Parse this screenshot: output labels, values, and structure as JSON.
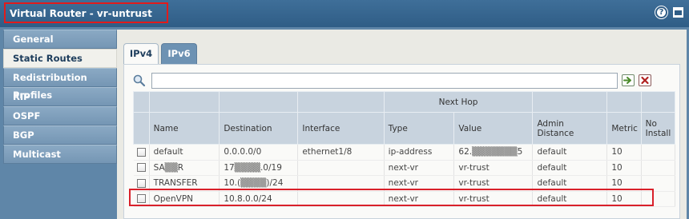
{
  "window": {
    "title": "Virtual Router - vr-untrust",
    "help_icon": "help-icon",
    "window_icon": "window-icon"
  },
  "nav": {
    "items": [
      {
        "label": "General",
        "active": false
      },
      {
        "label": "Static Routes",
        "active": true
      },
      {
        "label": "Redistribution Profiles",
        "active": false
      },
      {
        "label": "RIP",
        "active": false
      },
      {
        "label": "OSPF",
        "active": false
      },
      {
        "label": "BGP",
        "active": false
      },
      {
        "label": "Multicast",
        "active": false
      }
    ]
  },
  "tabs": [
    {
      "label": "IPv4",
      "active": true
    },
    {
      "label": "IPv6",
      "active": false
    }
  ],
  "search": {
    "value": "",
    "placeholder": ""
  },
  "table": {
    "group_header": "Next Hop",
    "columns": [
      "Name",
      "Destination",
      "Interface",
      "Type",
      "Value",
      "Admin Distance",
      "Metric",
      "No Install"
    ],
    "rows": [
      {
        "name": "default",
        "destination": "0.0.0.0/0",
        "interface": "ethernet1/8",
        "type": "ip-address",
        "value": "62.▒▒▒▒▒▒▒5",
        "admin_distance": "default",
        "metric": "10",
        "no_install": ""
      },
      {
        "name": "SA▒▒R",
        "destination": "17▒▒▒▒.0/19",
        "interface": "",
        "type": "next-vr",
        "value": "vr-trust",
        "admin_distance": "default",
        "metric": "10",
        "no_install": ""
      },
      {
        "name": "TRANSFER",
        "destination": "10.(▒▒▒▒)/24",
        "interface": "",
        "type": "next-vr",
        "value": "vr-trust",
        "admin_distance": "default",
        "metric": "10",
        "no_install": ""
      },
      {
        "name": "OpenVPN",
        "destination": "10.8.0.0/24",
        "interface": "",
        "type": "next-vr",
        "value": "vr-trust",
        "admin_distance": "default",
        "metric": "10",
        "no_install": ""
      }
    ]
  },
  "colors": {
    "titlebar": "#2f5d86",
    "highlight": "#d9202a",
    "nav_bg": "#7596b4"
  }
}
